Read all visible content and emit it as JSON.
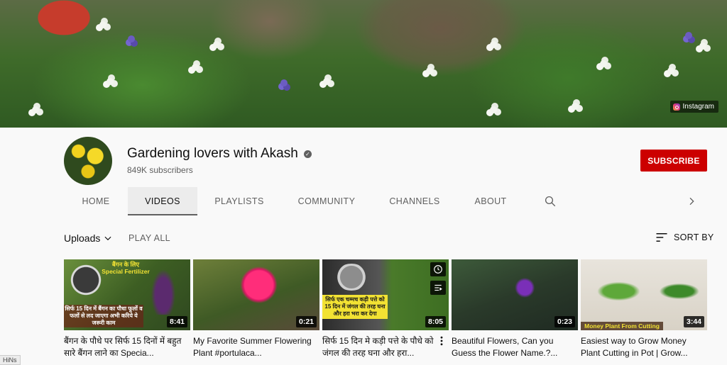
{
  "banner": {
    "link_label": "Instagram",
    "link_icon": "instagram-icon"
  },
  "channel": {
    "name": "Gardening lovers with Akash",
    "subscribers": "849K subscribers",
    "subscribe_label": "SUBSCRIBE",
    "verified_icon": "verified-check-icon"
  },
  "tabs": [
    {
      "label": "HOME",
      "active": false
    },
    {
      "label": "VIDEOS",
      "active": true
    },
    {
      "label": "PLAYLISTS",
      "active": false
    },
    {
      "label": "COMMUNITY",
      "active": false
    },
    {
      "label": "CHANNELS",
      "active": false
    },
    {
      "label": "ABOUT",
      "active": false
    }
  ],
  "toolbar": {
    "uploads_label": "Uploads",
    "play_all_label": "PLAY ALL",
    "sort_label": "SORT BY"
  },
  "videos": [
    {
      "title": "बैंगन के पौधे पर सिर्फ 15 दिनों में बहुत सारे बैंगन लाने का Specia...",
      "duration": "8:41",
      "thumb_text_top": "बैंगन के लिए Special Fertilizer",
      "thumb_text_bottom": "सिर्फ 15 दिन में बैंगन का पौधा फूलों व फलों से लद जाएगा अभी करिये ये जरूरी काम"
    },
    {
      "title": "My Favorite Summer Flowering Plant #portulaca...",
      "duration": "0:21"
    },
    {
      "title": "सिर्फ 15 दिन मे कड़ी पत्ते के पौधे को जंगल की तरह घना और हरा...",
      "duration": "8:05",
      "thumb_text": "सिर्फ एक चम्मच कड़ी पत्ते को 15 दिन में जंगल की तरह घना और हरा भरा कर देगा"
    },
    {
      "title": "Beautiful Flowers, Can you Guess the Flower Name.?...",
      "duration": "0:23"
    },
    {
      "title": "Easiest way to Grow Money Plant Cutting in Pot | Grow...",
      "duration": "3:44",
      "thumb_text": "Money Plant From Cutting"
    }
  ],
  "status_tag": "HiNs",
  "colors": {
    "subscribe": "#cc0000",
    "accent_text": "#0f0f0f",
    "muted_text": "#606060"
  }
}
